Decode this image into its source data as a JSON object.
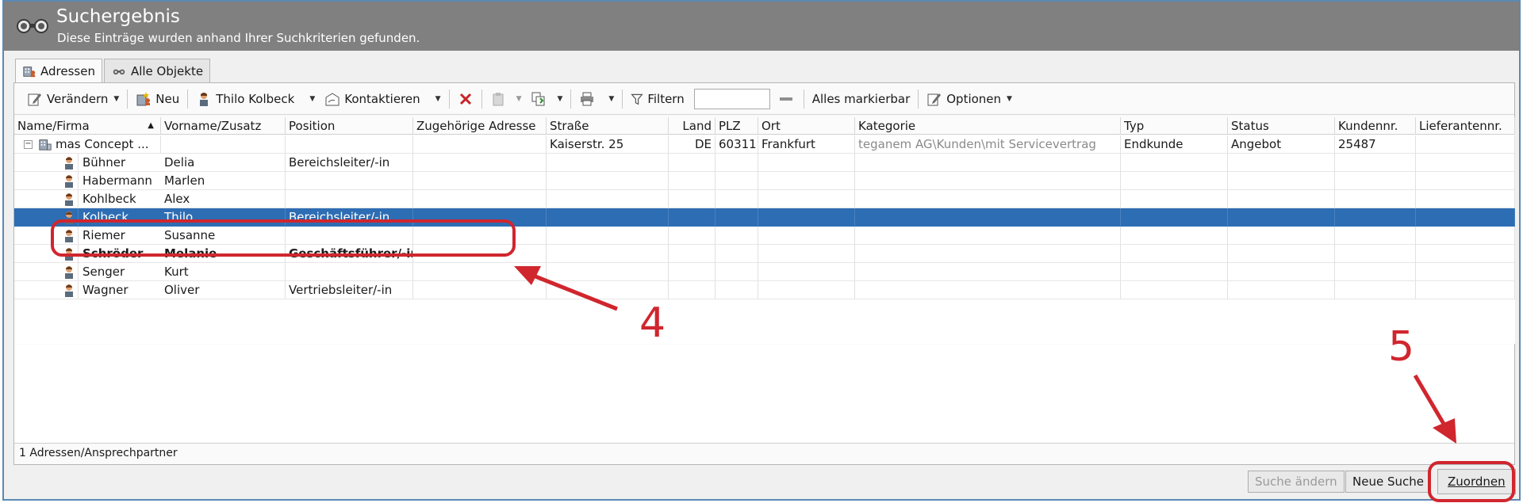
{
  "header": {
    "title": "Suchergebnis",
    "subtitle": "Diese Einträge wurden anhand Ihrer Suchkriterien gefunden."
  },
  "tabs": [
    {
      "label": "Adressen",
      "active": true
    },
    {
      "label": "Alle Objekte",
      "active": false
    }
  ],
  "toolbar": {
    "change_label": "Verändern",
    "new_label": "Neu",
    "user_label": "Thilo Kolbeck",
    "contact_label": "Kontaktieren",
    "filter_label": "Filtern",
    "filter_value": "",
    "mark_all_label": "Alles markierbar",
    "options_label": "Optionen"
  },
  "table": {
    "columns": [
      "Name/Firma",
      "Vorname/Zusatz",
      "Position",
      "Zugehörige Adresse",
      "Straße",
      "Land",
      "PLZ",
      "Ort",
      "Kategorie",
      "Typ",
      "Status",
      "Kundennr.",
      "Lieferantennr."
    ],
    "company": {
      "name": "mas Concept ...",
      "street": "Kaiserstr. 25",
      "country": "DE",
      "zip": "60311",
      "city": "Frankfurt",
      "category": "teganem AG\\Kunden\\mit Servicevertrag",
      "type": "Endkunde",
      "status": "Angebot",
      "customer_no": "25487"
    },
    "contacts": [
      {
        "last": "Bühner",
        "first": "Delia",
        "position": "Bereichsleiter/-in"
      },
      {
        "last": "Habermann",
        "first": "Marlen",
        "position": ""
      },
      {
        "last": "Kohlbeck",
        "first": "Alex",
        "position": ""
      },
      {
        "last": "Kolbeck",
        "first": "Thilo",
        "position": "Bereichsleiter/-in"
      },
      {
        "last": "Riemer",
        "first": "Susanne",
        "position": ""
      },
      {
        "last": "Schröder",
        "first": "Melanie",
        "position": "Geschäftsführer/-in"
      },
      {
        "last": "Senger",
        "first": "Kurt",
        "position": ""
      },
      {
        "last": "Wagner",
        "first": "Oliver",
        "position": "Vertriebsleiter/-in"
      }
    ],
    "selected_index": 3,
    "bold_index": 5
  },
  "status_text": "1 Adressen/Ansprechpartner",
  "footer": {
    "change_search_label": "Suche ändern",
    "new_search_label": "Neue Suche",
    "assign_label": "Zuordnen"
  },
  "annotations": {
    "step4": "4",
    "step5": "5",
    "color": "#d0262e"
  },
  "colors": {
    "header_bg": "#808080",
    "selection": "#2d6db3"
  }
}
